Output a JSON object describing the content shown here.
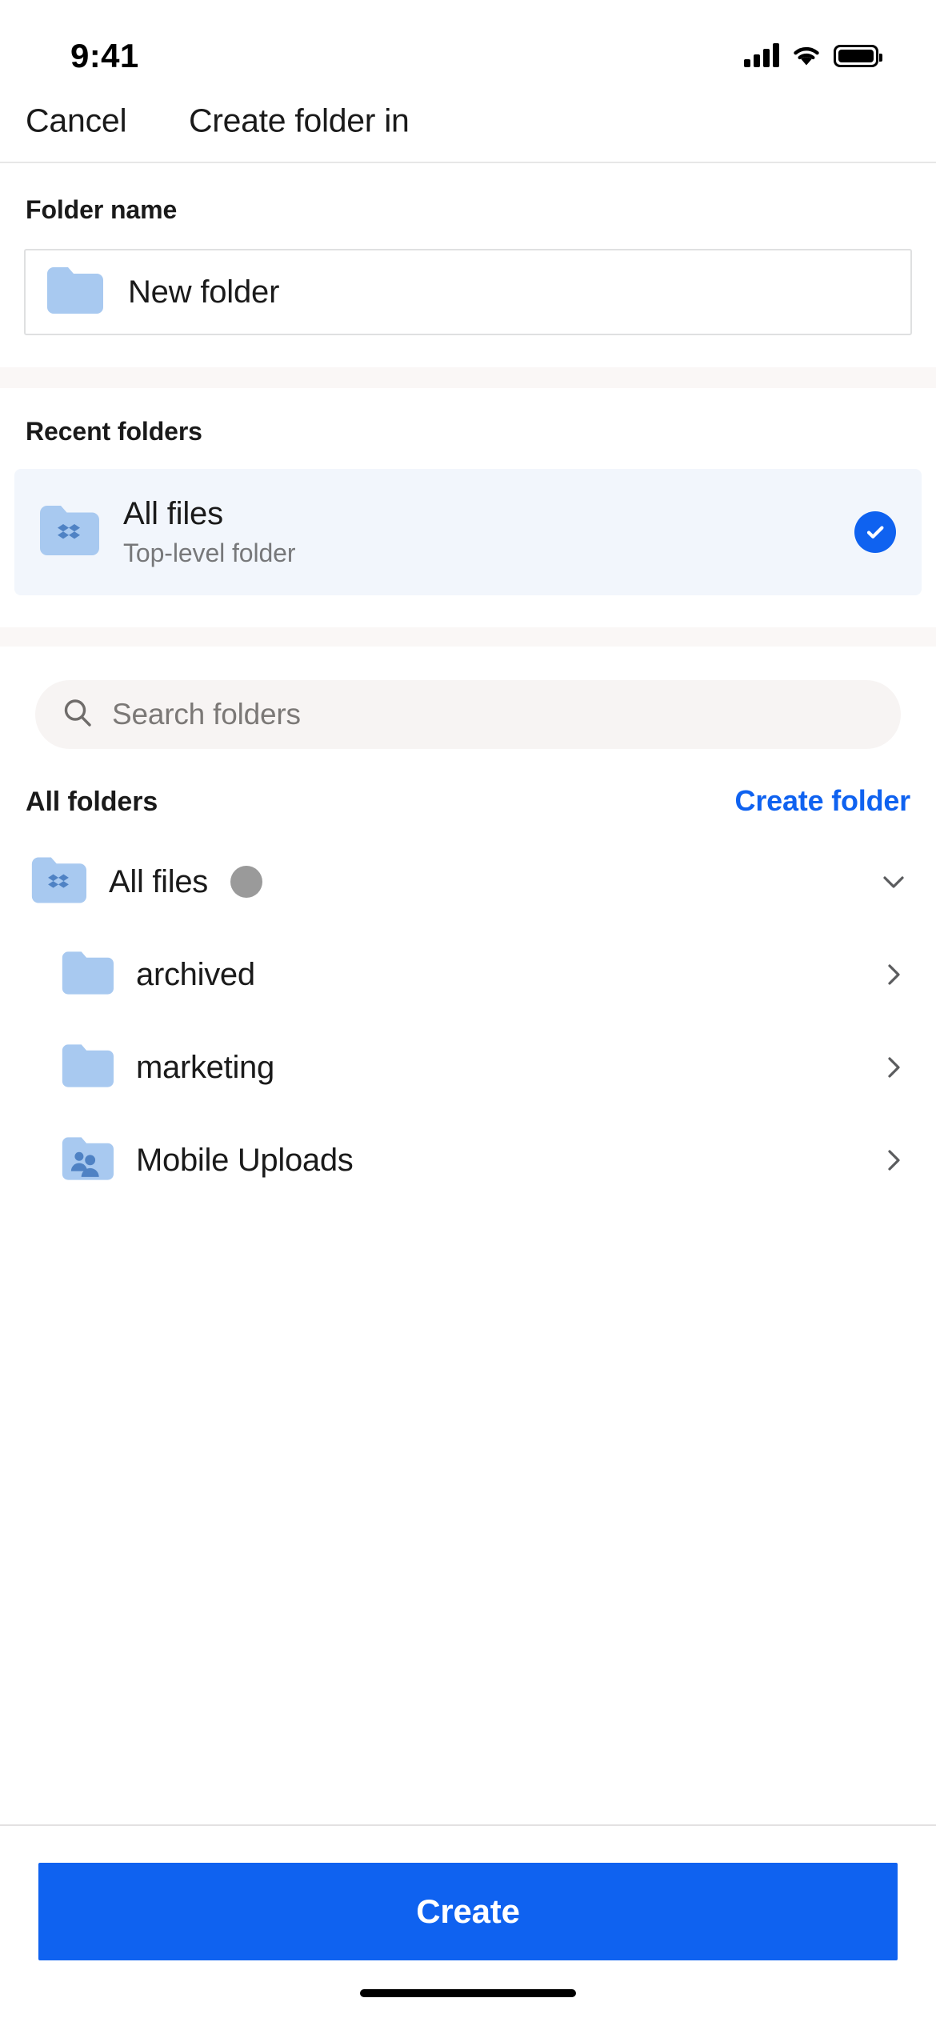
{
  "status_bar": {
    "time": "9:41",
    "cellular_icon": "signal-bars-icon",
    "wifi_icon": "wifi-icon",
    "battery_icon": "battery-icon"
  },
  "nav_bar": {
    "cancel_label": "Cancel",
    "title": "Create folder in"
  },
  "folder_name_section": {
    "label": "Folder name",
    "icon": "folder-icon",
    "value": "New folder",
    "placeholder": "Folder name"
  },
  "recent_folders_section": {
    "label": "Recent folders",
    "items": [
      {
        "icon": "dropbox-folder-icon",
        "title": "All files",
        "subtitle": "Top-level folder",
        "selected": true,
        "check_icon": "check-circle-icon"
      }
    ]
  },
  "browse_section": {
    "search": {
      "icon": "search-icon",
      "placeholder": "Search folders",
      "value": ""
    },
    "header": {
      "title": "All folders",
      "action_label": "Create folder"
    },
    "tree": [
      {
        "icon": "dropbox-folder-icon",
        "label": "All files",
        "level": 0,
        "badge": true,
        "trailing_icon": "chevron-down-icon"
      },
      {
        "icon": "folder-icon",
        "label": "archived",
        "level": 1,
        "badge": false,
        "trailing_icon": "chevron-right-icon"
      },
      {
        "icon": "folder-icon",
        "label": "marketing",
        "level": 1,
        "badge": false,
        "trailing_icon": "chevron-right-icon"
      },
      {
        "icon": "shared-folder-icon",
        "label": "Mobile Uploads",
        "level": 1,
        "badge": false,
        "trailing_icon": "chevron-right-icon"
      }
    ]
  },
  "footer": {
    "primary_button_label": "Create"
  },
  "colors": {
    "accent_blue": "#0f62f0",
    "folder_blue": "#a8c9f0",
    "selected_row_bg": "#f2f6fc",
    "band_gray": "#faf7f6",
    "search_bg": "#f7f4f3"
  }
}
